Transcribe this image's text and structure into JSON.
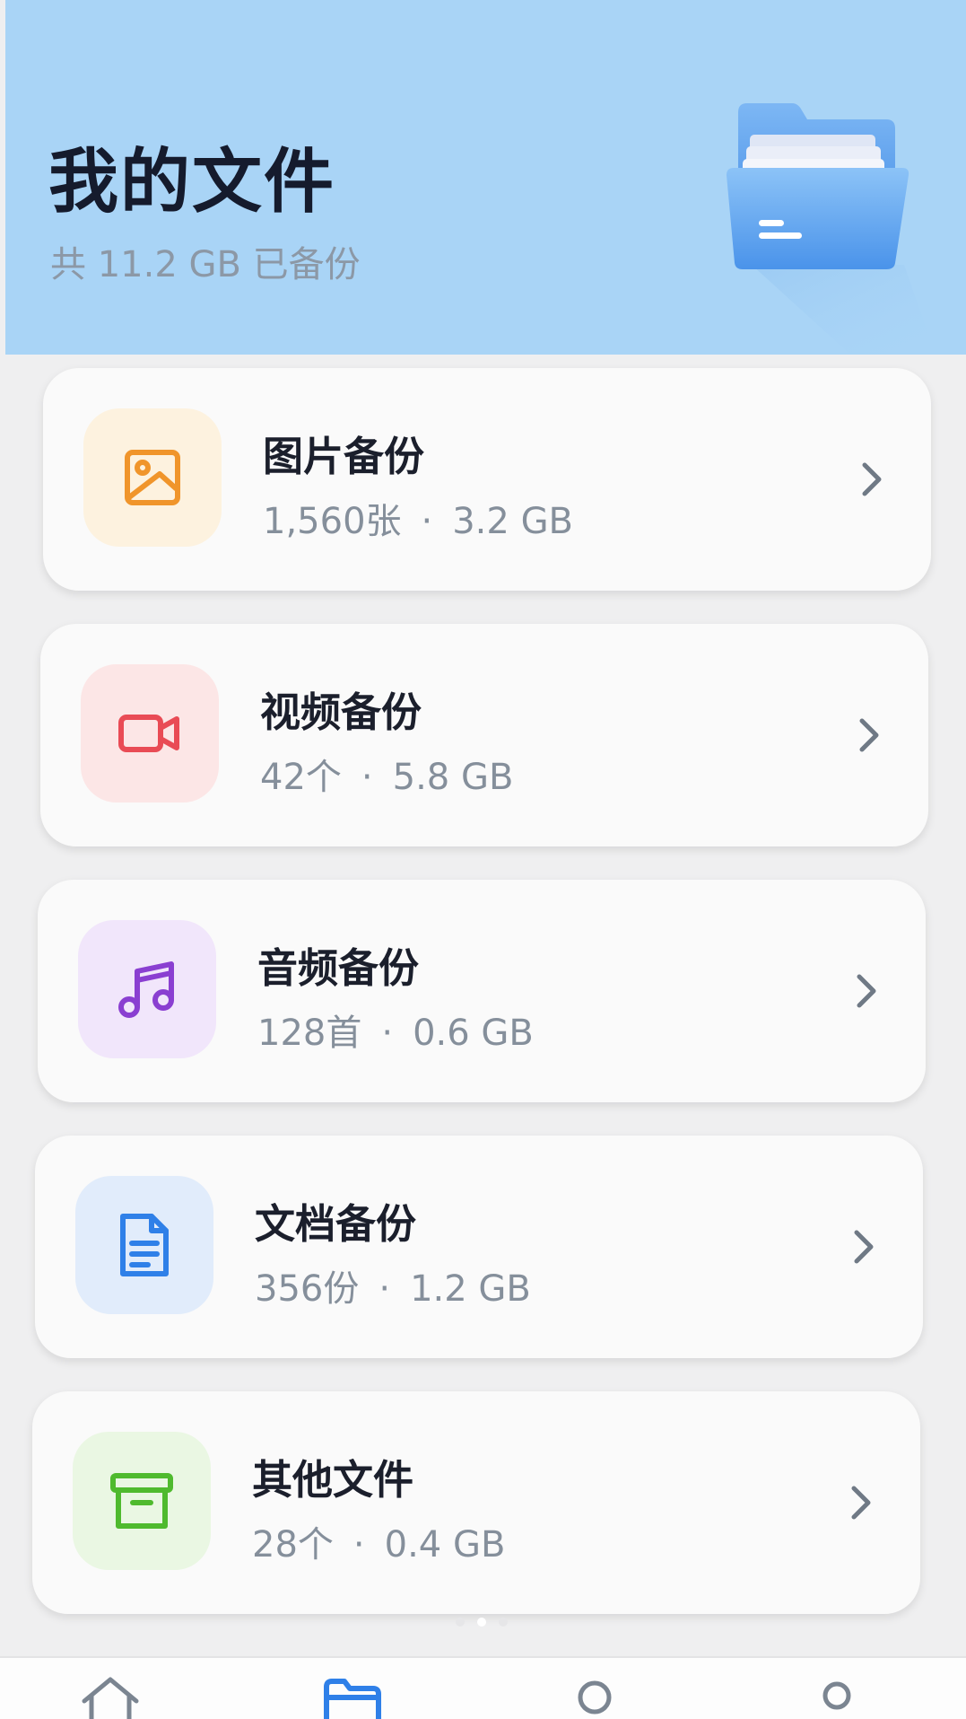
{
  "header": {
    "title": "我的文件",
    "subtitle": "共 11.2 GB 已备份",
    "illustration": "open-folder-illustration"
  },
  "categories": [
    {
      "name": "图片备份",
      "count": "1,560张",
      "size": "3.2 GB",
      "icon": "image-icon",
      "icon_color": "#f0952b",
      "icon_bg": "#fdf2df"
    },
    {
      "name": "视频备份",
      "count": "42个",
      "size": "5.8 GB",
      "icon": "video-camera-icon",
      "icon_color": "#e94b55",
      "icon_bg": "#fce6e6"
    },
    {
      "name": "音频备份",
      "count": "128首",
      "size": "0.6 GB",
      "icon": "music-note-icon",
      "icon_color": "#8a3fd1",
      "icon_bg": "#f1e6fb"
    },
    {
      "name": "文档备份",
      "count": "356份",
      "size": "1.2 GB",
      "icon": "document-icon",
      "icon_color": "#2f80e8",
      "icon_bg": "#e1ecfb"
    },
    {
      "name": "其他文件",
      "count": "28个",
      "size": "0.4 GB",
      "icon": "archive-box-icon",
      "icon_color": "#4fba2e",
      "icon_bg": "#eaf7e3"
    }
  ],
  "separator": "·",
  "pager": {
    "pages": 3,
    "active_index": 1
  },
  "tabbar": {
    "items": [
      {
        "icon": "home-icon",
        "active": false
      },
      {
        "icon": "folder-icon",
        "active": true
      },
      {
        "icon": "search-icon",
        "active": false
      },
      {
        "icon": "profile-icon",
        "active": false
      }
    ]
  },
  "colors": {
    "header_bg": "#a9d4f6",
    "page_bg": "#efeff0",
    "card_bg": "#fafafa",
    "title_text": "#151b2d",
    "muted_text": "#858f9b",
    "accent": "#2f80e8"
  }
}
